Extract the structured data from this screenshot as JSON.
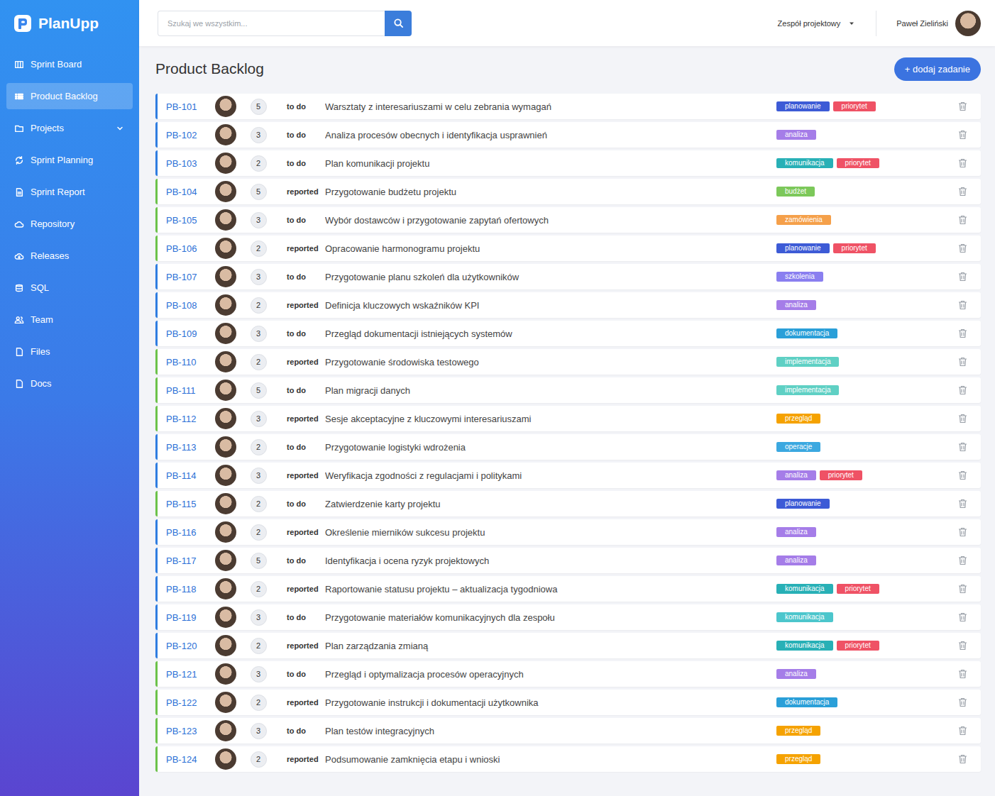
{
  "logo": {
    "text": "PlanUpp"
  },
  "sidebar": {
    "items": [
      {
        "label": "Sprint Board",
        "selected": false,
        "kind": "link"
      },
      {
        "label": "Product Backlog",
        "selected": true,
        "kind": "link"
      },
      {
        "label": "Projects",
        "selected": false,
        "kind": "group"
      },
      {
        "label": "Sprint Planning",
        "selected": false,
        "kind": "link"
      },
      {
        "label": "Sprint Report",
        "selected": false,
        "kind": "link"
      },
      {
        "label": "Repository",
        "selected": false,
        "kind": "link"
      },
      {
        "label": "Releases",
        "selected": false,
        "kind": "link"
      },
      {
        "label": "SQL",
        "selected": false,
        "kind": "link"
      },
      {
        "label": "Team",
        "selected": false,
        "kind": "link"
      },
      {
        "label": "Files",
        "selected": false,
        "kind": "link"
      },
      {
        "label": "Docs",
        "selected": false,
        "kind": "link"
      }
    ]
  },
  "topbar": {
    "search": {
      "placeholder": "Szukaj we wszystkim..."
    },
    "team_menu": {
      "label": "Zespół projektowy"
    },
    "user": {
      "name": "Paweł Zieliński"
    }
  },
  "page": {
    "title": "Product Backlog",
    "add_button": "+ dodaj zadanie"
  },
  "backlog": {
    "rows": [
      {
        "id": "PB-101",
        "points": "5",
        "status": "to do",
        "title": "Warsztaty z interesariuszami w celu zebrania wymagań",
        "color": "#2f7de1",
        "tags": [
          {
            "label": "planowanie",
            "color": "#3d5bd6"
          },
          {
            "label": "priorytet",
            "color": "#ef5265"
          }
        ]
      },
      {
        "id": "PB-102",
        "points": "3",
        "status": "to do",
        "title": "Analiza procesów obecnych i identyfikacja usprawnień",
        "color": "#2f7de1",
        "tags": [
          {
            "label": "analiza",
            "color": "#a57de8"
          }
        ]
      },
      {
        "id": "PB-103",
        "points": "2",
        "status": "to do",
        "title": "Plan komunikacji projektu",
        "color": "#2f7de1",
        "tags": [
          {
            "label": "komunikacja",
            "color": "#28b0b6"
          },
          {
            "label": "priorytet",
            "color": "#ef5265"
          }
        ]
      },
      {
        "id": "PB-104",
        "points": "5",
        "status": "reported",
        "title": "Przygotowanie budżetu projektu",
        "color": "#6cc24a",
        "tags": [
          {
            "label": "budżet",
            "color": "#7cc85a"
          }
        ]
      },
      {
        "id": "PB-105",
        "points": "3",
        "status": "to do",
        "title": "Wybór dostawców i przygotowanie zapytań ofertowych",
        "color": "#6cc24a",
        "tags": [
          {
            "label": "zamówienia",
            "color": "#f5a04a"
          }
        ]
      },
      {
        "id": "PB-106",
        "points": "2",
        "status": "reported",
        "title": "Opracowanie harmonogramu projektu",
        "color": "#6cc24a",
        "tags": [
          {
            "label": "planowanie",
            "color": "#3d5bd6"
          },
          {
            "label": "priorytet",
            "color": "#ef5265"
          }
        ]
      },
      {
        "id": "PB-107",
        "points": "3",
        "status": "to do",
        "title": "Przygotowanie planu szkoleń dla użytkowników",
        "color": "#2f7de1",
        "tags": [
          {
            "label": "szkolenia",
            "color": "#8a7ff0"
          }
        ]
      },
      {
        "id": "PB-108",
        "points": "2",
        "status": "reported",
        "title": "Definicja kluczowych wskaźników KPI",
        "color": "#2f7de1",
        "tags": [
          {
            "label": "analiza",
            "color": "#a57de8"
          }
        ]
      },
      {
        "id": "PB-109",
        "points": "3",
        "status": "to do",
        "title": "Przegląd dokumentacji istniejących systemów",
        "color": "#2f7de1",
        "tags": [
          {
            "label": "dokumentacja",
            "color": "#2a9fd8"
          }
        ]
      },
      {
        "id": "PB-110",
        "points": "2",
        "status": "reported",
        "title": "Przygotowanie środowiska testowego",
        "color": "#6cc24a",
        "tags": [
          {
            "label": "implementacja",
            "color": "#5fd0c4"
          }
        ]
      },
      {
        "id": "PB-111",
        "points": "5",
        "status": "to do",
        "title": "Plan migracji danych",
        "color": "#6cc24a",
        "tags": [
          {
            "label": "implementacja",
            "color": "#5fd0c4"
          }
        ]
      },
      {
        "id": "PB-112",
        "points": "3",
        "status": "reported",
        "title": "Sesje akceptacyjne z kluczowymi interesariuszami",
        "color": "#6cc24a",
        "tags": [
          {
            "label": "przegląd",
            "color": "#f5a200"
          }
        ]
      },
      {
        "id": "PB-113",
        "points": "2",
        "status": "to do",
        "title": "Przygotowanie logistyki wdrożenia",
        "color": "#2f7de1",
        "tags": [
          {
            "label": "operacje",
            "color": "#3ba8e0"
          }
        ]
      },
      {
        "id": "PB-114",
        "points": "3",
        "status": "reported",
        "title": "Weryfikacja zgodności z regulacjami i politykami",
        "color": "#2f7de1",
        "tags": [
          {
            "label": "analiza",
            "color": "#a57de8"
          },
          {
            "label": "priorytet",
            "color": "#ef5265"
          }
        ]
      },
      {
        "id": "PB-115",
        "points": "2",
        "status": "to do",
        "title": "Zatwierdzenie karty projektu",
        "color": "#6cc24a",
        "tags": [
          {
            "label": "planowanie",
            "color": "#3d5bd6"
          }
        ]
      },
      {
        "id": "PB-116",
        "points": "2",
        "status": "reported",
        "title": "Określenie mierników sukcesu projektu",
        "color": "#2f7de1",
        "tags": [
          {
            "label": "analiza",
            "color": "#a57de8"
          }
        ]
      },
      {
        "id": "PB-117",
        "points": "5",
        "status": "to do",
        "title": "Identyfikacja i ocena ryzyk projektowych",
        "color": "#2f7de1",
        "tags": [
          {
            "label": "analiza",
            "color": "#a57de8"
          }
        ]
      },
      {
        "id": "PB-118",
        "points": "2",
        "status": "reported",
        "title": "Raportowanie statusu projektu – aktualizacja tygodniowa",
        "color": "#2f7de1",
        "tags": [
          {
            "label": "komunikacja",
            "color": "#28b0b6"
          },
          {
            "label": "priorytet",
            "color": "#ef5265"
          }
        ]
      },
      {
        "id": "PB-119",
        "points": "3",
        "status": "to do",
        "title": "Przygotowanie materiałów komunikacyjnych dla zespołu",
        "color": "#2f7de1",
        "tags": [
          {
            "label": "komunikacja",
            "color": "#4cc6cc"
          }
        ]
      },
      {
        "id": "PB-120",
        "points": "2",
        "status": "reported",
        "title": "Plan zarządzania zmianą",
        "color": "#2f7de1",
        "tags": [
          {
            "label": "komunikacja",
            "color": "#28b0b6"
          },
          {
            "label": "priorytet",
            "color": "#ef5265"
          }
        ]
      },
      {
        "id": "PB-121",
        "points": "3",
        "status": "to do",
        "title": "Przegląd i optymalizacja procesów operacyjnych",
        "color": "#6cc24a",
        "tags": [
          {
            "label": "analiza",
            "color": "#a57de8"
          }
        ]
      },
      {
        "id": "PB-122",
        "points": "2",
        "status": "reported",
        "title": "Przygotowanie instrukcji i dokumentacji użytkownika",
        "color": "#6cc24a",
        "tags": [
          {
            "label": "dokumentacja",
            "color": "#2a9fd8"
          }
        ]
      },
      {
        "id": "PB-123",
        "points": "3",
        "status": "to do",
        "title": "Plan testów integracyjnych",
        "color": "#6cc24a",
        "tags": [
          {
            "label": "przegląd",
            "color": "#f5a200"
          }
        ]
      },
      {
        "id": "PB-124",
        "points": "2",
        "status": "reported",
        "title": "Podsumowanie zamknięcia etapu i wnioski",
        "color": "#6cc24a",
        "tags": [
          {
            "label": "przegląd",
            "color": "#f5a200"
          }
        ]
      }
    ]
  }
}
